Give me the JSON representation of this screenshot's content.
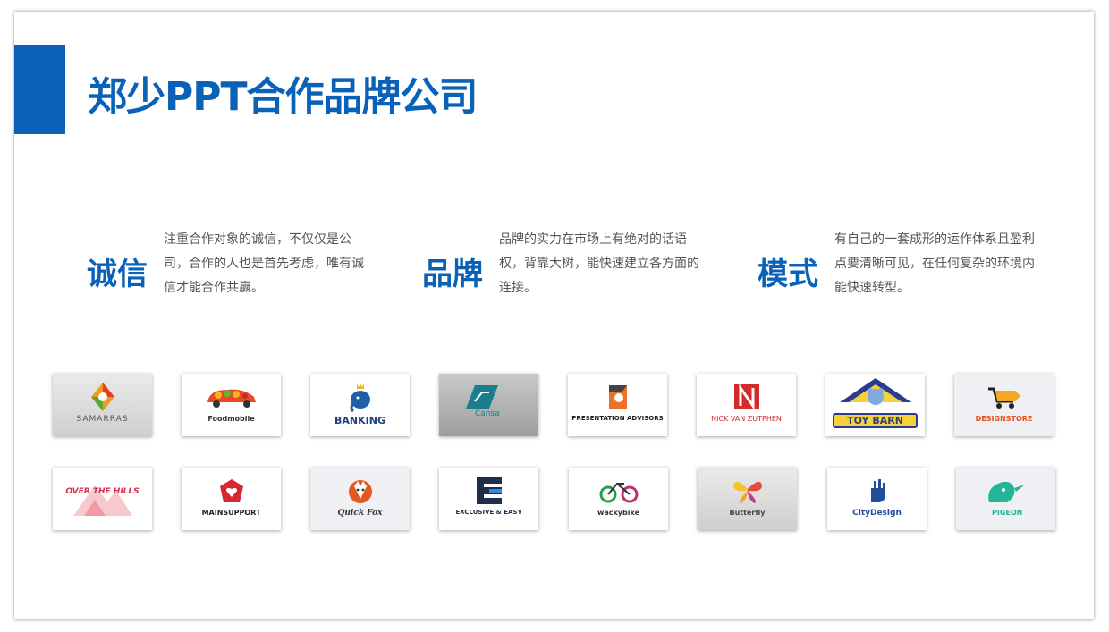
{
  "title": "郑少PPT合作品牌公司",
  "pillars": [
    {
      "heading": "诚信",
      "text": "注重合作对象的诚信，不仅仅是公司，合作的人也是首先考虑，唯有诚信才能合作共赢。"
    },
    {
      "heading": "品牌",
      "text": "品牌的实力在市场上有绝对的话语权，背靠大树，能快速建立各方面的连接。"
    },
    {
      "heading": "模式",
      "text": "有自己的一套成形的运作体系且盈利点要清晰可见，在任何复杂的环境内能快速转型。"
    }
  ],
  "logos": [
    {
      "name": "SAMARRAS",
      "icon": "leaf-drop-icon"
    },
    {
      "name": "Foodmobile",
      "icon": "food-car-icon"
    },
    {
      "name": "BANKING",
      "icon": "elephant-crown-icon"
    },
    {
      "name": "Cansa",
      "icon": "parallelogram-icon"
    },
    {
      "name": "PRESENTATION ADVISORS",
      "icon": "p-cube-icon"
    },
    {
      "name": "NICK VAN ZUTPHEN",
      "icon": "n-fold-icon"
    },
    {
      "name": "TOY BARN",
      "icon": "bear-barn-icon"
    },
    {
      "name": "DESIGNSTORE",
      "icon": "cart-pencil-icon"
    },
    {
      "name": "OVER THE HILLS",
      "icon": "mountain-icon"
    },
    {
      "name": "MAINSUPPORT",
      "icon": "shield-heart-icon"
    },
    {
      "name": "Quick Fox",
      "icon": "fox-icon"
    },
    {
      "name": "EXCLUSIVE & EASY",
      "icon": "e-block-icon"
    },
    {
      "name": "wackybike",
      "icon": "bike-icon"
    },
    {
      "name": "Butterfly",
      "icon": "butterfly-icon"
    },
    {
      "name": "CityDesign",
      "icon": "hand-icon"
    },
    {
      "name": "PIGEON",
      "icon": "pigeon-icon"
    }
  ],
  "colors": {
    "accent": "#0a62b8"
  }
}
